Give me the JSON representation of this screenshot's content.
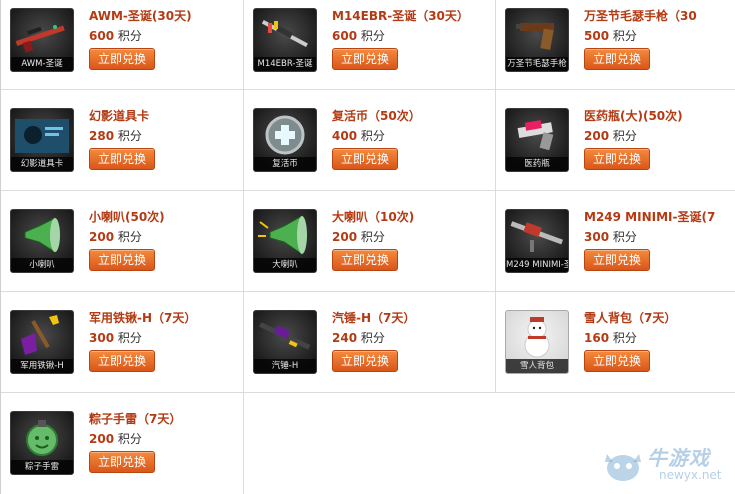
{
  "items": [
    {
      "name": "AWM-圣诞(30天)",
      "points": "600",
      "unit": "积分",
      "caption": "AWM-圣诞",
      "button": "立即兑换",
      "icon": "sniper-rifle-icon"
    },
    {
      "name": "M14EBR-圣诞（30天）",
      "points": "600",
      "unit": "积分",
      "caption": "M14EBR-圣诞",
      "button": "立即兑换",
      "icon": "rifle-icon"
    },
    {
      "name": "万圣节毛瑟手枪（30",
      "points": "500",
      "unit": "积分",
      "caption": "万圣节毛瑟手枪",
      "button": "立即兑换",
      "icon": "pistol-icon"
    },
    {
      "name": "幻影道具卡",
      "points": "280",
      "unit": "积分",
      "caption": "幻影道具卡",
      "button": "立即兑换",
      "icon": "phantom-card-icon"
    },
    {
      "name": "复活币（50次）",
      "points": "400",
      "unit": "积分",
      "caption": "复活币",
      "button": "立即兑换",
      "icon": "revive-coin-icon"
    },
    {
      "name": "医药瓶(大)(50次)",
      "points": "200",
      "unit": "积分",
      "caption": "医药瓶",
      "button": "立即兑换",
      "icon": "medicine-bottle-icon"
    },
    {
      "name": "小喇叭(50次)",
      "points": "200",
      "unit": "积分",
      "caption": "小喇叭",
      "button": "立即兑换",
      "icon": "small-horn-icon"
    },
    {
      "name": "大喇叭（10次)",
      "points": "200",
      "unit": "积分",
      "caption": "大喇叭",
      "button": "立即兑换",
      "icon": "big-horn-icon"
    },
    {
      "name": "M249 MINIMI-圣诞(7",
      "points": "300",
      "unit": "积分",
      "caption": "M249 MINIMI-圣诞",
      "button": "立即兑换",
      "icon": "machine-gun-icon"
    },
    {
      "name": "军用铁锹-H（7天）",
      "points": "300",
      "unit": "积分",
      "caption": "军用铁锹-H",
      "button": "立即兑换",
      "icon": "shovel-icon"
    },
    {
      "name": "汽锤-H（7天）",
      "points": "240",
      "unit": "积分",
      "caption": "汽锤-H",
      "button": "立即兑换",
      "icon": "shotgun-icon"
    },
    {
      "name": "雪人背包（7天）",
      "points": "160",
      "unit": "积分",
      "caption": "雪人背包",
      "button": "立即兑换",
      "icon": "snowman-backpack-icon"
    },
    {
      "name": "粽子手雷（7天）",
      "points": "200",
      "unit": "积分",
      "caption": "粽子手雷",
      "button": "立即兑换",
      "icon": "grenade-icon"
    }
  ],
  "watermark": {
    "text": "牛游戏",
    "url": "newyx.net"
  },
  "colors": {
    "accent": "#b33a12",
    "button": "#e8692b",
    "border": "#dcdcdc"
  }
}
